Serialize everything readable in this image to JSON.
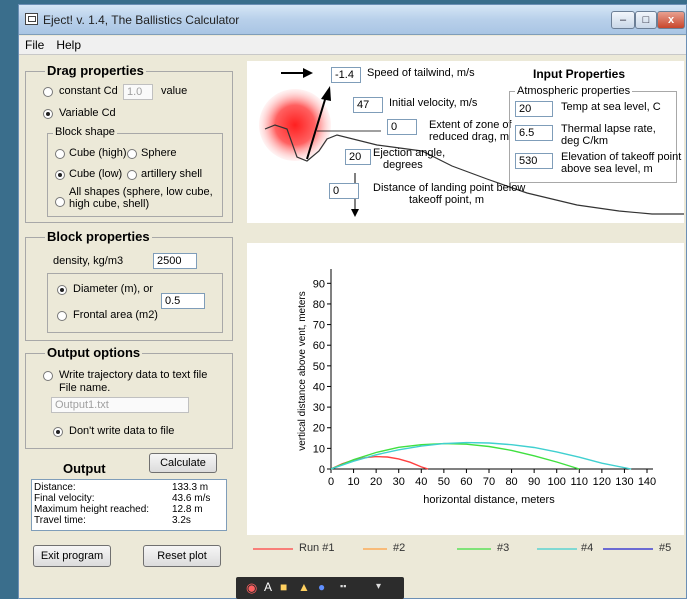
{
  "window": {
    "title": "Eject! v. 1.4, The Ballistics Calculator",
    "min": "–",
    "max": "□",
    "close": "x"
  },
  "menu": [
    "File",
    "Help"
  ],
  "drag": {
    "title": "Drag properties",
    "constant_cd": "constant Cd",
    "constant_value": "1.0",
    "value_label": "value",
    "variable_cd": "Variable Cd",
    "block_shape": "Block shape",
    "cube_high": "Cube (high)",
    "sphere": "Sphere",
    "cube_low": "Cube (low)",
    "artillery": "artillery shell",
    "all_shapes_1": "All shapes (sphere, low cube,",
    "all_shapes_2": "high  cube, shell)"
  },
  "block": {
    "title": "Block properties",
    "density_label": "density, kg/m3",
    "density": "2500",
    "diameter": "Diameter (m), or",
    "frontal": "Frontal area (m2)",
    "size": "0.5"
  },
  "output_options": {
    "title": "Output options",
    "write_1": "Write trajectory data to text file",
    "file_name": "File name.",
    "file": "Output1.txt",
    "dont_write": "Don't write data to file"
  },
  "output": {
    "title": "Output",
    "calculate": "Calculate",
    "rows": [
      {
        "k": "Distance:",
        "v": "133.3 m"
      },
      {
        "k": "Final velocity:",
        "v": "43.6 m/s"
      },
      {
        "k": "Maximum height reached:",
        "v": "12.8 m"
      },
      {
        "k": "Travel time:",
        "v": "3.2s"
      }
    ]
  },
  "buttons": {
    "exit": "Exit program",
    "reset": "Reset plot"
  },
  "input": {
    "title": "Input Properties",
    "tailwind": "-1.4",
    "tailwind_label": "Speed of tailwind, m/s",
    "velocity": "47",
    "velocity_label": "Initial velocity, m/s",
    "zone": "0",
    "zone_label_1": "Extent of zone of",
    "zone_label_2": "reduced drag, m",
    "angle": "20",
    "angle_label_1": "Ejection angle,",
    "angle_label_2": "degrees",
    "landing": "0",
    "landing_label_1": "Distance of landing point below",
    "landing_label_2": "takeoff point, m",
    "atmos_title": "Atmospheric properties",
    "temp": "20",
    "temp_label": "Temp at sea level, C",
    "lapse": "6.5",
    "lapse_label_1": "Thermal lapse rate,",
    "lapse_label_2": "deg C/km",
    "elev": "530",
    "elev_label_1": "Elevation of takeoff point",
    "elev_label_2": "above sea level, m"
  },
  "colors": {
    "run1": "#ff4040",
    "run2": "#ffa040",
    "run3": "#40e040",
    "run4": "#40d0d0",
    "run5": "#2020d0"
  },
  "chart_data": {
    "type": "line",
    "xlabel": "horizontal distance, meters",
    "ylabel": "vertical distance above vent, meters",
    "xlim": [
      0,
      140
    ],
    "ylim": [
      0,
      95
    ],
    "xticks": [
      0,
      10,
      20,
      30,
      40,
      50,
      60,
      70,
      80,
      90,
      100,
      110,
      120,
      130,
      140
    ],
    "yticks": [
      0,
      10,
      20,
      30,
      40,
      50,
      60,
      70,
      80,
      90
    ],
    "series": [
      {
        "name": "Run #1",
        "color": "#ff4040",
        "x": [
          0,
          5,
          10,
          15,
          20,
          25,
          30,
          35,
          40,
          43
        ],
        "y": [
          0,
          2.5,
          4.3,
          5.5,
          6.0,
          5.8,
          4.9,
          3.3,
          1.0,
          0
        ]
      },
      {
        "name": "#2",
        "color": "#ffa040",
        "x": [],
        "y": []
      },
      {
        "name": "#3",
        "color": "#40e040",
        "x": [
          0,
          10,
          20,
          30,
          40,
          50,
          60,
          70,
          80,
          90,
          100,
          110
        ],
        "y": [
          0,
          4.5,
          8.0,
          10.5,
          11.8,
          12.3,
          12.0,
          10.9,
          9.0,
          6.4,
          3.4,
          0
        ]
      },
      {
        "name": "#4",
        "color": "#40d0d0",
        "x": [
          0,
          10,
          20,
          30,
          40,
          50,
          60,
          70,
          80,
          90,
          100,
          110,
          120,
          133
        ],
        "y": [
          0,
          3.8,
          6.9,
          9.3,
          11.1,
          12.3,
          12.8,
          12.6,
          11.8,
          10.4,
          8.3,
          5.7,
          2.8,
          0
        ]
      },
      {
        "name": "#5",
        "color": "#2020d0",
        "x": [],
        "y": []
      }
    ]
  }
}
